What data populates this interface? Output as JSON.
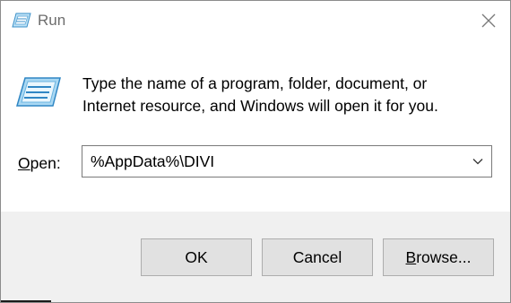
{
  "window": {
    "title": "Run",
    "close_icon": "close-icon",
    "app_icon": "run-icon"
  },
  "body": {
    "description_line1": "Type the name of a program, folder, document, or",
    "description_line2": "Internet resource, and Windows will open it for you.",
    "open_label_mnemonic": "O",
    "open_label_rest": "pen:",
    "open_value": "%AppData%\\DIVI",
    "dropdown_icon": "chevron-down-icon"
  },
  "buttons": {
    "ok": "OK",
    "cancel": "Cancel",
    "browse_mnemonic": "B",
    "browse_rest": "rowse..."
  },
  "colors": {
    "footer_bg": "#f0f0f0",
    "button_bg": "#e1e1e1",
    "button_border": "#adadad",
    "title_text": "#6d6d6d"
  }
}
